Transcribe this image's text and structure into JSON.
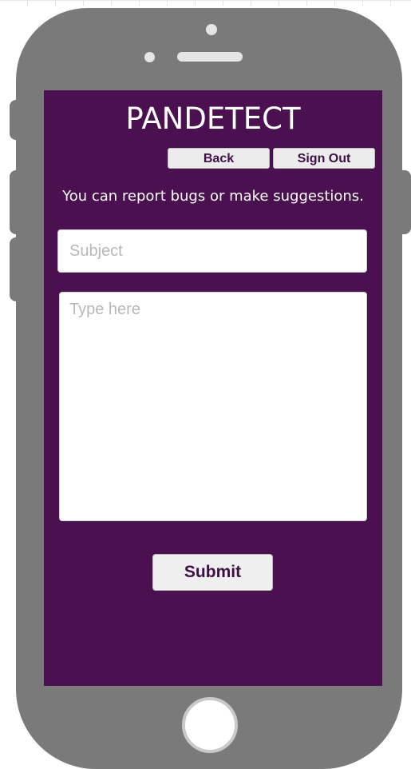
{
  "app": {
    "title": "PANDETECT"
  },
  "nav": {
    "back_label": "Back",
    "signout_label": "Sign Out"
  },
  "form": {
    "info_text": "You can report bugs or make suggestions.",
    "subject_placeholder": "Subject",
    "subject_value": "",
    "message_placeholder": "Type here",
    "message_value": "",
    "submit_label": "Submit"
  },
  "colors": {
    "screen_background": "#4a1050",
    "phone_body": "#7a7a7a",
    "button_text": "#3d1045",
    "button_background": "#ececec"
  }
}
